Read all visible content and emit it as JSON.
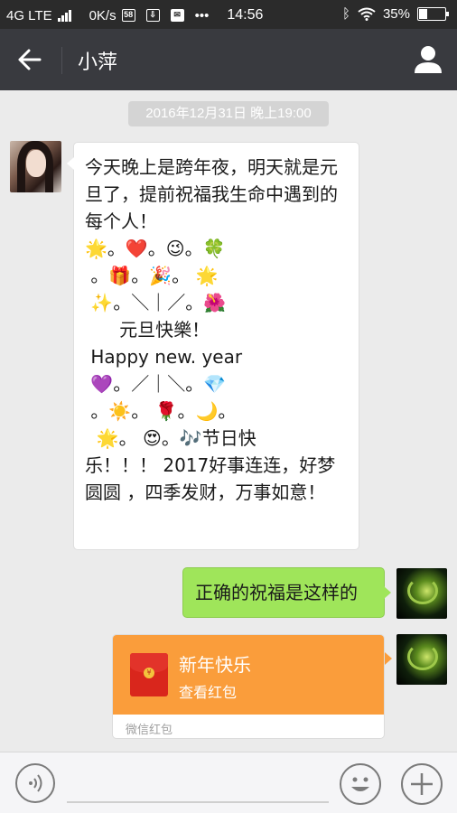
{
  "status_bar": {
    "network": "4G LTE",
    "speed": "0K/s",
    "time": "14:56",
    "battery": "35%",
    "battery_level": 0.35
  },
  "header": {
    "title": "小萍"
  },
  "chat": {
    "timestamp": "2016年12月31日 晚上19:00",
    "messages": [
      {
        "side": "left",
        "lines": [
          "今天晚上是跨年夜，明天就是元旦了，提前祝福我生命中遇到的每个人！",
          "🌟。❤️。😉。🍀",
          " 。🎁。🎉。 🌟",
          " ✨。＼｜／。🌺",
          "      元旦快樂！",
          " Happy new. year",
          " 💜。／｜＼。💎",
          " 。☀️。 🌹。🌙。",
          "  🌟。 😍。🎶节日快",
          "乐！！！ 2017好事连连，好梦圆圆 ，四季发财，万事如意！"
        ]
      },
      {
        "side": "right",
        "text": "正确的祝福是这样的"
      },
      {
        "side": "right",
        "type": "red_packet",
        "title": "新年快乐",
        "subtitle": "查看红包",
        "footer": "微信红包"
      }
    ]
  },
  "input_bar": {
    "voice_icon": "voice-icon",
    "emoji_icon": "emoji-icon",
    "plus_icon": "plus-icon"
  },
  "colors": {
    "nav_bg": "#393a3f",
    "chat_bg": "#ebebeb",
    "bubble_right": "#9fe55a",
    "red_packet": "#fa9d3b"
  }
}
